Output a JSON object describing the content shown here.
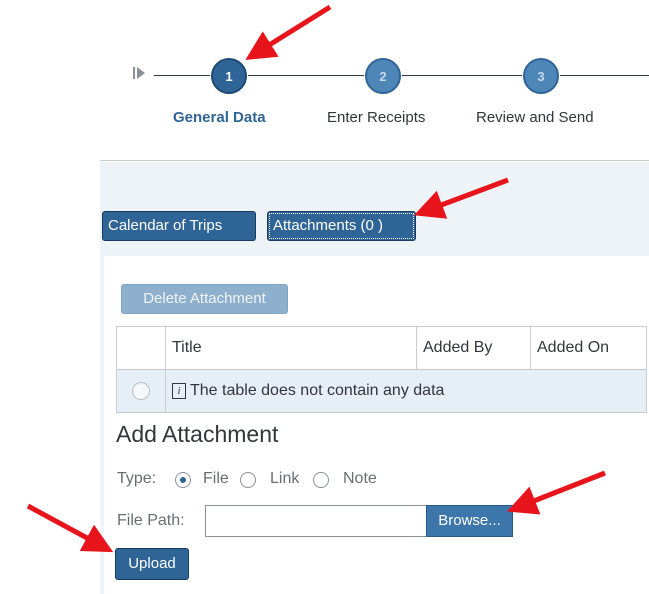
{
  "roadmap": {
    "steps": [
      {
        "number": "1",
        "label": "General Data",
        "state": "active"
      },
      {
        "number": "2",
        "label": "Enter Receipts",
        "state": "inactive"
      },
      {
        "number": "3",
        "label": "Review and Send",
        "state": "inactive"
      }
    ],
    "start_icon": "roadmap-start-icon"
  },
  "tabs": {
    "calendar": "Calendar of Trips",
    "attachments": "Attachments (0 )"
  },
  "toolbar": {
    "delete_label": "Delete Attachment"
  },
  "table": {
    "columns": [
      "",
      "Title",
      "Added By",
      "Added On"
    ],
    "empty_message": "The table does not contain any data",
    "info_icon_glyph": "i"
  },
  "add_attachment": {
    "title": "Add Attachment",
    "type_label": "Type:",
    "options": [
      {
        "label": "File",
        "checked": true
      },
      {
        "label": "Link",
        "checked": false
      },
      {
        "label": "Note",
        "checked": false
      }
    ],
    "file_path_label": "File Path:",
    "file_path_value": "",
    "browse_label": "Browse...",
    "upload_label": "Upload"
  },
  "colors": {
    "accent": "#2f6596",
    "annotation_arrow": "#e8141b"
  }
}
